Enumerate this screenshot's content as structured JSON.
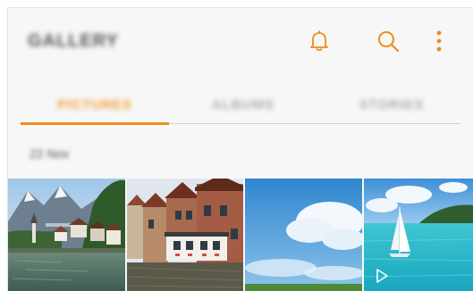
{
  "app_title": "GALLERY",
  "header_icons": [
    "bell-icon",
    "search-icon",
    "more-options-icon"
  ],
  "tabs": [
    {
      "label": "PICTURES",
      "active": true
    },
    {
      "label": "ALBUMS",
      "active": false
    },
    {
      "label": "STORIES",
      "active": false
    }
  ],
  "date_group": "22 Nov",
  "thumbnails": [
    {
      "subject": "lakeside mountain village",
      "type": "image"
    },
    {
      "subject": "canal with brick houses",
      "type": "image"
    },
    {
      "subject": "blue sky with clouds",
      "type": "image"
    },
    {
      "subject": "sailboat on turquoise sea",
      "type": "video"
    }
  ],
  "colors": {
    "accent": "#f08c1a",
    "background": "#f7f7f7"
  }
}
